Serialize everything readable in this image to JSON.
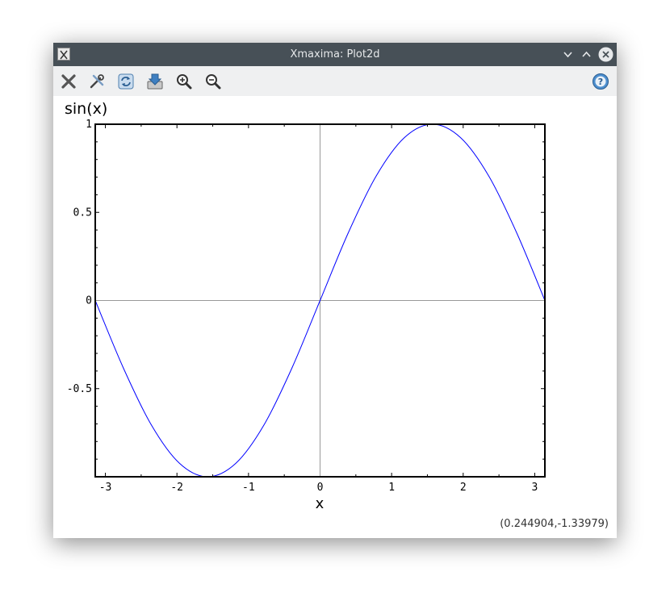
{
  "window": {
    "title": "Xmaxima: Plot2d",
    "title_buttons": [
      "minimize-icon",
      "maximize-icon",
      "close-icon"
    ]
  },
  "toolbar": {
    "tools": [
      "close-plot-icon",
      "config-icon",
      "replot-icon",
      "save-icon",
      "zoom-in-icon",
      "zoom-out-icon"
    ],
    "help": "help-icon"
  },
  "status": {
    "coordinates": "(0.244904,-1.33979)"
  },
  "chart_data": {
    "type": "line",
    "title": "sin(x)",
    "xlabel": "x",
    "ylabel": "",
    "xlim": [
      -3.14159,
      3.14159
    ],
    "ylim": [
      -1,
      1
    ],
    "xticks": [
      "-3",
      "-2",
      "-1",
      "0",
      "1",
      "2",
      "3"
    ],
    "yticks": [
      "1",
      "0.5",
      "0",
      "-0.5"
    ],
    "grid": false,
    "axes_lines": true,
    "series": [
      {
        "name": "",
        "color": "#0000ff",
        "x": [
          -3.14159,
          -2.74889,
          -2.35619,
          -1.9635,
          -1.5708,
          -1.1781,
          -0.7854,
          -0.3927,
          0,
          0.3927,
          0.7854,
          1.1781,
          1.5708,
          1.9635,
          2.35619,
          2.74889,
          3.14159
        ],
        "y": [
          0,
          -0.38268,
          -0.70711,
          -0.92388,
          -1,
          -0.92388,
          -0.70711,
          -0.38268,
          0,
          0.38268,
          0.70711,
          0.92388,
          1,
          0.92388,
          0.70711,
          0.38268,
          0
        ]
      }
    ]
  }
}
